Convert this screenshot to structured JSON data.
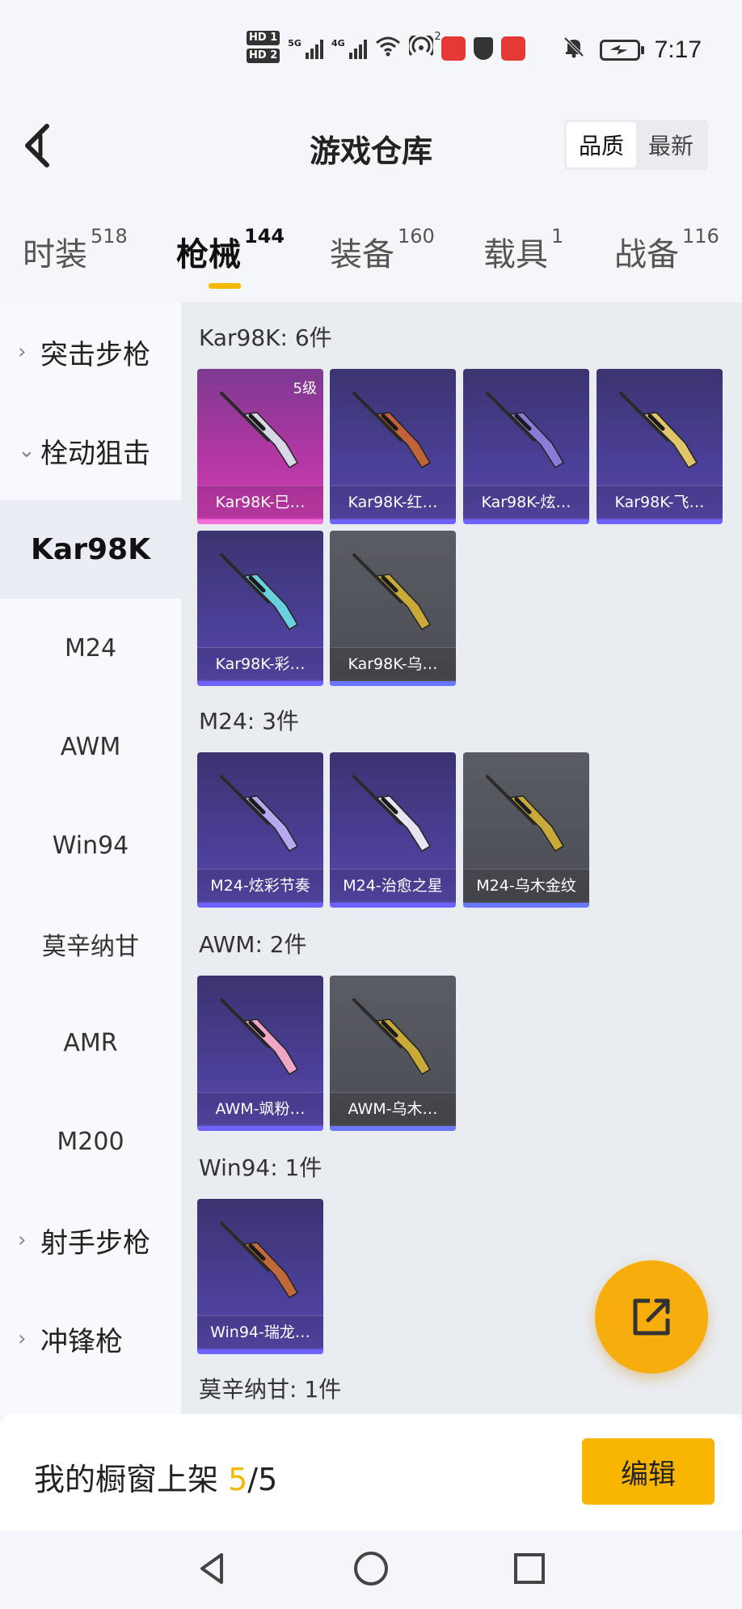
{
  "status_bar": {
    "hd1": "HD 1",
    "hd2": "HD 2",
    "network1": "5G",
    "network2": "4G",
    "hotspot_count": "2",
    "time": "7:17"
  },
  "header": {
    "title": "游戏仓库",
    "sort_quality": "品质",
    "sort_newest": "最新"
  },
  "tabs": [
    {
      "label": "时装",
      "count": "518"
    },
    {
      "label": "枪械",
      "count": "144"
    },
    {
      "label": "装备",
      "count": "160"
    },
    {
      "label": "载具",
      "count": "1"
    },
    {
      "label": "战备",
      "count": "116"
    }
  ],
  "sidebar": {
    "items": [
      {
        "label": "突击步枪",
        "arrow": "›"
      },
      {
        "label": "栓动狙击",
        "arrow": "⌄"
      },
      {
        "label": "Kar98K"
      },
      {
        "label": "M24"
      },
      {
        "label": "AWM"
      },
      {
        "label": "Win94"
      },
      {
        "label": "莫辛纳甘"
      },
      {
        "label": "AMR"
      },
      {
        "label": "M200"
      },
      {
        "label": "射手步枪",
        "arrow": "›"
      },
      {
        "label": "冲锋枪",
        "arrow": "›"
      }
    ]
  },
  "groups": [
    {
      "title": "Kar98K: 6件",
      "items": [
        {
          "name": "Kar98K-巳…",
          "level": "5级",
          "gun_color": "#d9d7e8"
        },
        {
          "name": "Kar98K-红…",
          "gun_color": "#c0623a"
        },
        {
          "name": "Kar98K-炫…",
          "gun_color": "#8a7bd8"
        },
        {
          "name": "Kar98K-飞…",
          "gun_color": "#e0c56a"
        },
        {
          "name": "Kar98K-彩…",
          "gun_color": "#6ad0e0"
        },
        {
          "name": "Kar98K-乌…",
          "gun_color": "#c9a93a"
        }
      ]
    },
    {
      "title": "M24: 3件",
      "items": [
        {
          "name": "M24-炫彩节奏",
          "gun_color": "#b7a9ef"
        },
        {
          "name": "M24-治愈之星",
          "gun_color": "#e8e4f4"
        },
        {
          "name": "M24-乌木金纹",
          "gun_color": "#c9a93a"
        }
      ]
    },
    {
      "title": "AWM: 2件",
      "items": [
        {
          "name": "AWM-飒粉…",
          "gun_color": "#f0a7c5"
        },
        {
          "name": "AWM-乌木…",
          "gun_color": "#c9a93a"
        }
      ]
    },
    {
      "title": "Win94: 1件",
      "items": [
        {
          "name": "Win94-瑞龙…",
          "gun_color": "#c06a3a"
        }
      ]
    },
    {
      "title": "莫辛纳甘: 1件",
      "items": []
    }
  ],
  "bottom": {
    "shelf_label": "我的橱窗上架",
    "shelf_current": "5",
    "shelf_total": "/5",
    "edit_label": "编辑"
  },
  "colors": {
    "accent": "#f7b500",
    "fab": "#f7ad0c",
    "card_purple": "#4a3f96",
    "card_pink": "#b637a6",
    "card_gray": "#4b4d54"
  }
}
